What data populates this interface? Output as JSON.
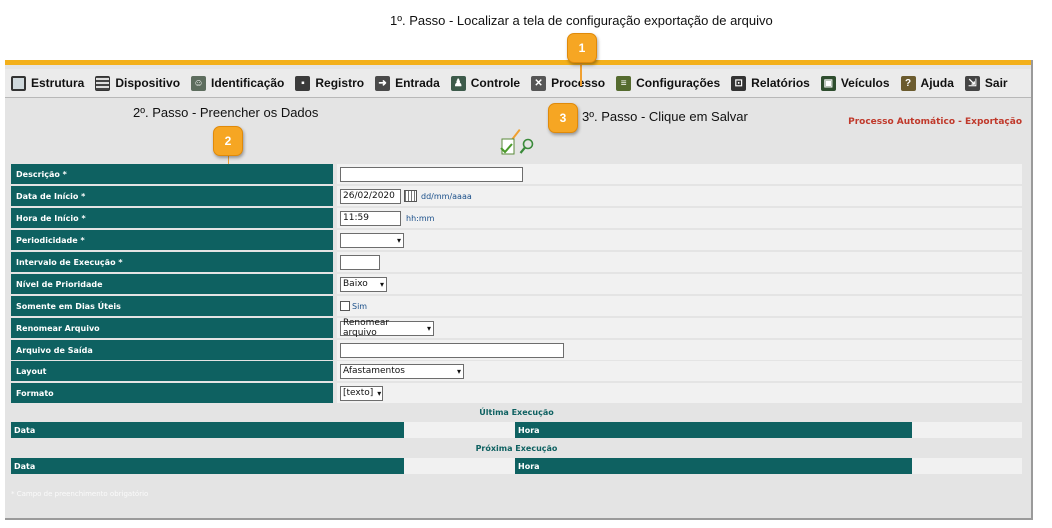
{
  "annotations": {
    "step1": "1º. Passo - Localizar a tela de configuração exportação de arquivo",
    "step2": "2º. Passo - Preencher os Dados",
    "step3": "3º. Passo - Clique em Salvar",
    "callout1": "1",
    "callout2": "2",
    "callout3": "3"
  },
  "menu": {
    "items": [
      {
        "label": "Estrutura",
        "icon": "structure-icon"
      },
      {
        "label": "Dispositivo",
        "icon": "device-icon"
      },
      {
        "label": "Identificação",
        "icon": "identification-icon"
      },
      {
        "label": "Registro",
        "icon": "registry-icon"
      },
      {
        "label": "Entrada",
        "icon": "entry-icon"
      },
      {
        "label": "Controle",
        "icon": "control-icon"
      },
      {
        "label": "Processo",
        "icon": "process-icon"
      },
      {
        "label": "Configurações",
        "icon": "settings-icon"
      },
      {
        "label": "Relatórios",
        "icon": "reports-icon"
      },
      {
        "label": "Veículos",
        "icon": "vehicles-icon"
      },
      {
        "label": "Ajuda",
        "icon": "help-icon"
      },
      {
        "label": "Sair",
        "icon": "exit-icon"
      }
    ]
  },
  "page_title": "Processo Automático - Exportação",
  "form": {
    "descricao_label": "Descrição *",
    "descricao_value": "",
    "data_inicio_label": "Data de Início *",
    "data_inicio_value": "26/02/2020",
    "data_inicio_hint": "dd/mm/aaaa",
    "hora_inicio_label": "Hora de Início *",
    "hora_inicio_value": "11:59",
    "hora_inicio_hint": "hh:mm",
    "periodicidade_label": "Periodicidade *",
    "periodicidade_value": "",
    "intervalo_label": "Intervalo de Execução *",
    "intervalo_value": "",
    "prioridade_label": "Nível de Prioridade",
    "prioridade_value": "Baixo",
    "dias_uteis_label": "Somente em Dias Úteis",
    "dias_uteis_option": "Sim",
    "renomear_label": "Renomear Arquivo",
    "renomear_value": "Renomear arquivo",
    "arquivo_saida_label": "Arquivo de Saída",
    "arquivo_saida_value": "",
    "layout_label": "Layout",
    "layout_value": "Afastamentos",
    "formato_label": "Formato",
    "formato_value": "[texto]"
  },
  "ultima_execucao": {
    "title": "Última Execução",
    "data_label": "Data",
    "hora_label": "Hora"
  },
  "proxima_execucao": {
    "title": "Próxima Execução",
    "data_label": "Data",
    "hora_label": "Hora"
  },
  "footnote": "* Campo de preenchimento obrigatório",
  "colors": {
    "label_bg": "#0e6161",
    "accent_bar": "#f3b01b",
    "callout": "#f6a623",
    "title_red": "#c0392b"
  }
}
